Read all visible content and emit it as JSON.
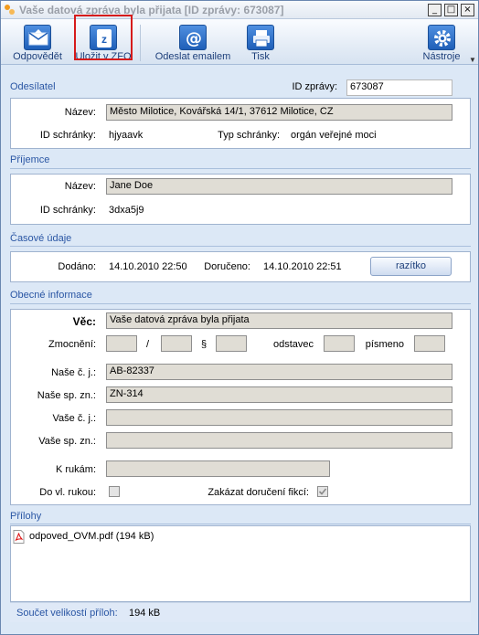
{
  "window": {
    "title": "Vaše datová zpráva byla přijata [ID zprávy: 673087]"
  },
  "toolbar": {
    "reply": "Odpovědět",
    "save_zfo": "Uložit v ZFO",
    "send_email": "Odeslat emailem",
    "print": "Tisk",
    "tools": "Nástroje"
  },
  "sender": {
    "heading": "Odesílatel",
    "msg_id_label": "ID zprávy:",
    "msg_id": "673087",
    "name_label": "Název:",
    "name": "Město Milotice, Kovářská 14/1, 37612 Milotice, CZ",
    "box_id_label": "ID schránky:",
    "box_id": "hjyaavk",
    "box_type_label": "Typ schránky:",
    "box_type": "orgán veřejné moci"
  },
  "recipient": {
    "heading": "Příjemce",
    "name_label": "Název:",
    "name": "Jane Doe",
    "box_id_label": "ID schránky:",
    "box_id": "3dxa5j9"
  },
  "time": {
    "heading": "Časové údaje",
    "delivered_label": "Dodáno:",
    "delivered": "14.10.2010 22:50",
    "received_label": "Doručeno:",
    "received": "14.10.2010 22:51",
    "stamp_button": "razítko"
  },
  "general": {
    "heading": "Obecné informace",
    "subject_label": "Věc:",
    "subject": "Vaše datová zpráva byla přijata",
    "authorization_label": "Zmocnění:",
    "slash": "/",
    "paragraph": "§",
    "clause_label": "odstavec",
    "letter_label": "písmeno",
    "our_ref_label": "Naše č. j.:",
    "our_ref": "AB-82337",
    "our_file_label": "Naše sp. zn.:",
    "our_file": "ZN-314",
    "your_ref_label": "Vaše č. j.:",
    "your_ref": "",
    "your_file_label": "Vaše sp. zn.:",
    "your_file": "",
    "attention_label": "K rukám:",
    "attention": "",
    "personal_label": "Do vl. rukou:",
    "fiction_label": "Zakázat doručení fikcí:",
    "fiction_checked": true
  },
  "attachments": {
    "heading": "Přílohy",
    "items": [
      {
        "name": "odpoved_OVM.pdf (194 kB)",
        "icon": "pdf-icon"
      }
    ],
    "total_label": "Součet velikostí příloh:",
    "total": "194 kB"
  },
  "colors": {
    "accent": "#2a56a4",
    "highlight": "#d61b1b"
  }
}
